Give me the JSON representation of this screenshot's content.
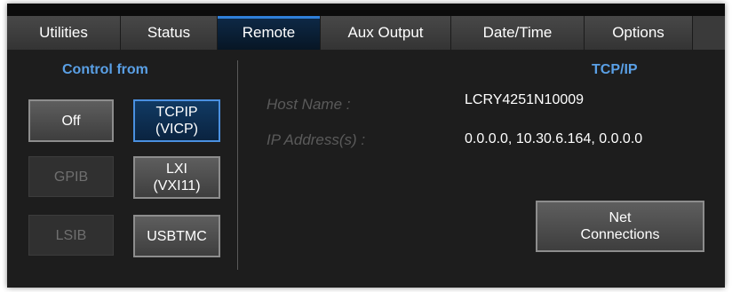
{
  "tabs": [
    {
      "label": "Utilities"
    },
    {
      "label": "Status"
    },
    {
      "label": "Remote"
    },
    {
      "label": "Aux Output"
    },
    {
      "label": "Date/Time"
    },
    {
      "label": "Options"
    }
  ],
  "active_tab": "Remote",
  "control_from": {
    "title": "Control from",
    "off": "Off",
    "tcpip_line1": "TCPIP",
    "tcpip_line2": "(VICP)",
    "gpib": "GPIB",
    "lxi_line1": "LXI",
    "lxi_line2": "(VXI11)",
    "lsib": "LSIB",
    "usbtmc": "USBTMC",
    "selected": "TCPIP (VICP)"
  },
  "tcpip": {
    "title": "TCP/IP",
    "host_name_label": "Host Name :",
    "host_name_value": "LCRY4251N10009",
    "ip_label": "IP Address(s) :",
    "ip_value": "0.0.0.0, 10.30.6.164, 0.0.0.0",
    "net_line1": "Net",
    "net_line2": "Connections"
  },
  "colors": {
    "accent": "#2f7fd8",
    "title_blue": "#5aa0e6",
    "selected_fill": "#0a2340"
  }
}
